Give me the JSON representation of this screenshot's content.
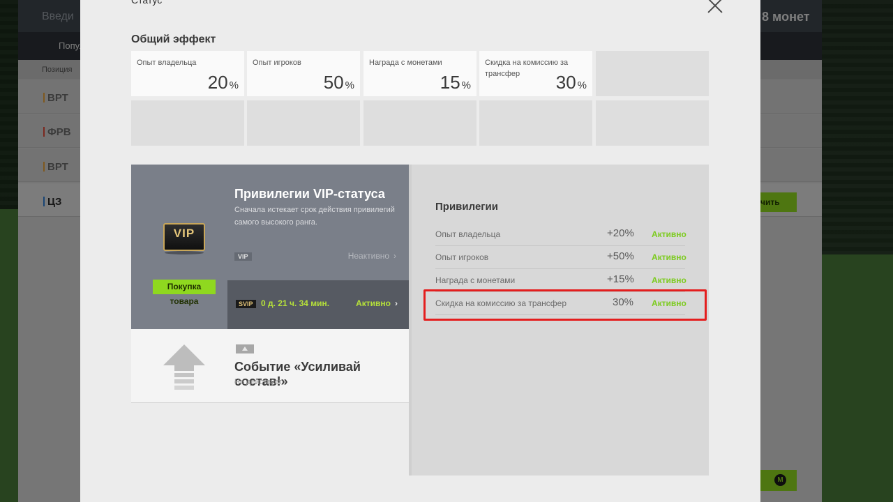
{
  "background": {
    "search_placeholder": "Введи",
    "coins_text": "8 монет",
    "subnav_label": "Попул",
    "table_header": "Позиция",
    "rows": [
      {
        "pos": "ВРТ",
        "color": "#e8a33a"
      },
      {
        "pos": "ФРВ",
        "color": "#e04a3a"
      },
      {
        "pos": "ВРТ",
        "color": "#e8a33a"
      },
      {
        "pos": "ЦЗ",
        "color": "#2e7fd6"
      }
    ],
    "green_button_label": "чить",
    "coin_icon": "М"
  },
  "modal": {
    "title": "Статус",
    "overall_effect": {
      "title": "Общий эффект",
      "cells": [
        {
          "label": "Опыт владельца",
          "value": "20",
          "unit": "%"
        },
        {
          "label": "Опыт игроков",
          "value": "50",
          "unit": "%"
        },
        {
          "label": "Награда с монетами",
          "value": "15",
          "unit": "%"
        },
        {
          "label": "Скидка на комиссию за трансфер",
          "value": "30",
          "unit": "%"
        }
      ]
    },
    "vip": {
      "badge": "VIP",
      "title": "Привилегии VIP-статуса",
      "description": "Сначала истекает срок действия привилегий самого высокого ранга.",
      "buy_button": "Покупка товара",
      "vip_tag": "VIP",
      "vip_status": "Неактивно",
      "svip_tag": "SVIP",
      "svip_time": "0 д. 21 ч. 34 мин.",
      "svip_status": "Активно"
    },
    "event": {
      "title": "Событие «Усиливай состав!»",
      "status": "Не действует"
    },
    "privileges": {
      "title": "Привилегии",
      "rows": [
        {
          "label": "Опыт владельца",
          "value": "+20%",
          "status": "Активно"
        },
        {
          "label": "Опыт игроков",
          "value": "+50%",
          "status": "Активно"
        },
        {
          "label": "Награда с монетами",
          "value": "+15%",
          "status": "Активно"
        },
        {
          "label": "Скидка на комиссию за трансфер",
          "value": "30%",
          "status": "Активно"
        }
      ]
    }
  }
}
